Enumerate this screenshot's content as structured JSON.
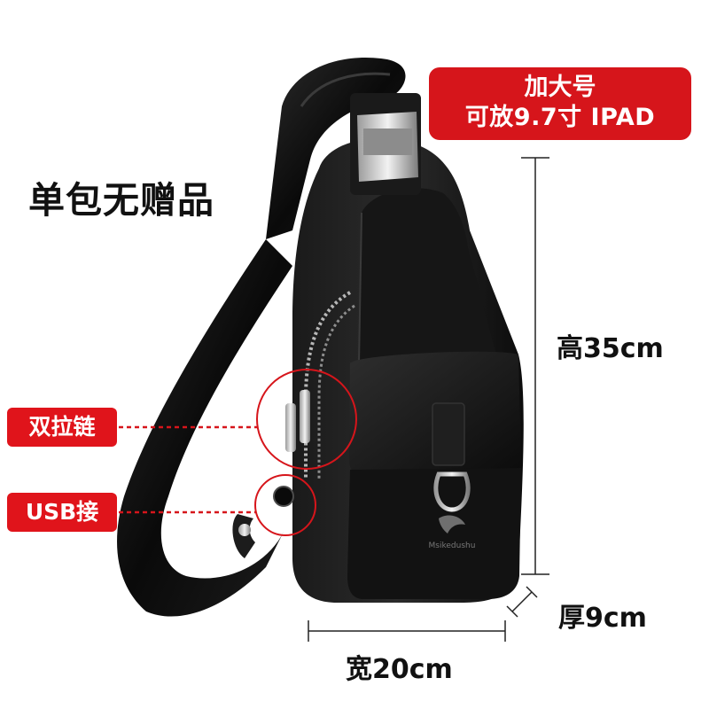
{
  "badge": {
    "line1": "加大号",
    "line2": "可放9.7寸 IPAD"
  },
  "headline": "单包无赠品",
  "callouts": {
    "zipper_label": "双拉链",
    "usb_label": "USB接口"
  },
  "dimensions": {
    "height": "高35cm",
    "thickness": "厚9cm",
    "width": "宽20cm"
  },
  "product_image": {
    "icon": "sling-bag-icon",
    "color": "#0d0d0d",
    "logo_text": "Msikedushu"
  },
  "colors": {
    "accent_red": "#d6151b",
    "text": "#111111",
    "dim_line": "#222222"
  }
}
